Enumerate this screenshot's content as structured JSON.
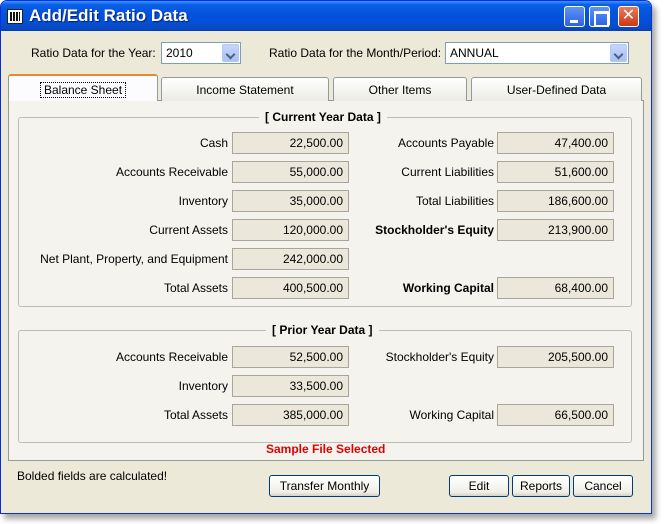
{
  "window": {
    "title": "Add/Edit Ratio Data"
  },
  "selectors": {
    "year_label": "Ratio Data for the Year:",
    "year_value": "2010",
    "period_label": "Ratio Data for the Month/Period:",
    "period_value": "ANNUAL"
  },
  "tabs": [
    {
      "label": "Balance Sheet"
    },
    {
      "label": "Income Statement"
    },
    {
      "label": "Other Items"
    },
    {
      "label": "User-Defined Data"
    }
  ],
  "current_year": {
    "title": "[ Current Year Data ]",
    "left": [
      {
        "label": "Cash",
        "value": "22,500.00"
      },
      {
        "label": "Accounts Receivable",
        "value": "55,000.00"
      },
      {
        "label": "Inventory",
        "value": "35,000.00"
      },
      {
        "label": "Current Assets",
        "value": "120,000.00"
      },
      {
        "label": "Net Plant, Property, and Equipment",
        "value": "242,000.00"
      },
      {
        "label": "Total Assets",
        "value": "400,500.00"
      }
    ],
    "right": [
      {
        "label": "Accounts Payable",
        "value": "47,400.00"
      },
      {
        "label": "Current Liabilities",
        "value": "51,600.00"
      },
      {
        "label": "Total Liabilities",
        "value": "186,600.00"
      },
      {
        "label": "Stockholder's Equity",
        "value": "213,900.00"
      },
      {
        "label": "Working Capital",
        "value": "68,400.00"
      }
    ]
  },
  "prior_year": {
    "title": "[ Prior Year Data ]",
    "left": [
      {
        "label": "Accounts Receivable",
        "value": "52,500.00"
      },
      {
        "label": "Inventory",
        "value": "33,500.00"
      },
      {
        "label": "Total Assets",
        "value": "385,000.00"
      }
    ],
    "right": [
      {
        "label": "Stockholder's Equity",
        "value": "205,500.00"
      },
      {
        "label": "Working Capital",
        "value": "66,500.00"
      }
    ]
  },
  "status": {
    "sample_text": "Sample File Selected"
  },
  "footer": {
    "note": "Bolded fields are calculated!",
    "transfer_label": "Transfer Monthly",
    "edit_label": "Edit",
    "reports_label": "Reports",
    "cancel_label": "Cancel"
  }
}
